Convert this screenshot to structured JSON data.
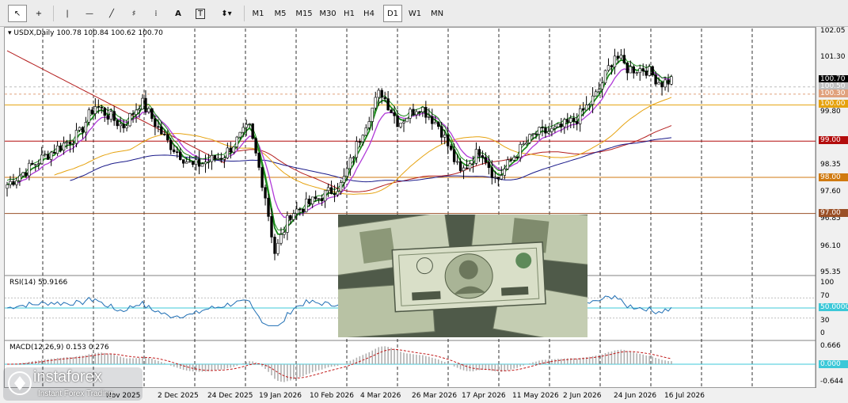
{
  "toolbar": {
    "tools": [
      {
        "name": "cursor-tool",
        "glyph": "↖"
      },
      {
        "name": "crosshair-tool",
        "glyph": "+"
      },
      {
        "name": "vertical-line-tool",
        "glyph": "|"
      },
      {
        "name": "horizontal-line-tool",
        "glyph": "—"
      },
      {
        "name": "trendline-tool",
        "glyph": "╱"
      },
      {
        "name": "fibonacci-fan-tool",
        "glyph": "♯"
      },
      {
        "name": "fibonacci-retracement-tool",
        "glyph": "⁞"
      },
      {
        "name": "text-tool",
        "glyph": "A"
      },
      {
        "name": "text-label-tool",
        "glyph": "T"
      },
      {
        "name": "shapes-menu",
        "glyph": "⬍▾"
      }
    ],
    "timeframes": [
      "M1",
      "M5",
      "M15",
      "M30",
      "H1",
      "H4",
      "D1",
      "W1",
      "MN"
    ],
    "selected_timeframe": "D1"
  },
  "chart": {
    "symbol": "USDX,Daily",
    "ohlc": "100.78 100.84 100.62 100.70",
    "price_ticks": [
      "102.05",
      "101.30",
      "99.80",
      "98.35",
      "97.60",
      "96.85",
      "96.10",
      "95.35"
    ],
    "price_tags": [
      {
        "value": "100.70",
        "color": "#000000"
      },
      {
        "value": "100.50",
        "color": "#c0c0c0"
      },
      {
        "value": "100.30",
        "color": "#e0a17c"
      },
      {
        "value": "100.00",
        "color": "#e6a20e"
      },
      {
        "value": "99.00",
        "color": "#b30c0c"
      },
      {
        "value": "98.00",
        "color": "#d07a10"
      },
      {
        "value": "97.00",
        "color": "#9a4f26"
      }
    ],
    "dates": [
      "Nov 2025",
      "2 Dec 2025",
      "24 Dec 2025",
      "19 Jan 2026",
      "10 Feb 2026",
      "4 Mar 2026",
      "26 Mar 2026",
      "17 Apr 2026",
      "11 May 2026",
      "2 Jun 2026",
      "24 Jun 2026",
      "16 Jul 2026"
    ]
  },
  "rsi": {
    "label": "RSI(14) 50.9166",
    "levels": [
      "100",
      "70",
      "50",
      "30",
      "0"
    ],
    "tag": "50.0000"
  },
  "macd": {
    "label": "MACD(12,26,9) 0.153 0.276",
    "levels": [
      "0.666",
      "-0.644"
    ],
    "tag": "0.000"
  },
  "watermark": {
    "brand": "instaforex",
    "tagline": "Instant Forex Trading"
  },
  "colors": {
    "bull_candle": "#ffffff",
    "bear_candle": "#000000",
    "green_ma": "#1a8a1a",
    "violet_ma": "#b03ad8",
    "orange_ma": "#e6a20e",
    "navy_ma": "#1a1a8a",
    "red_ma": "#b41e1e"
  }
}
